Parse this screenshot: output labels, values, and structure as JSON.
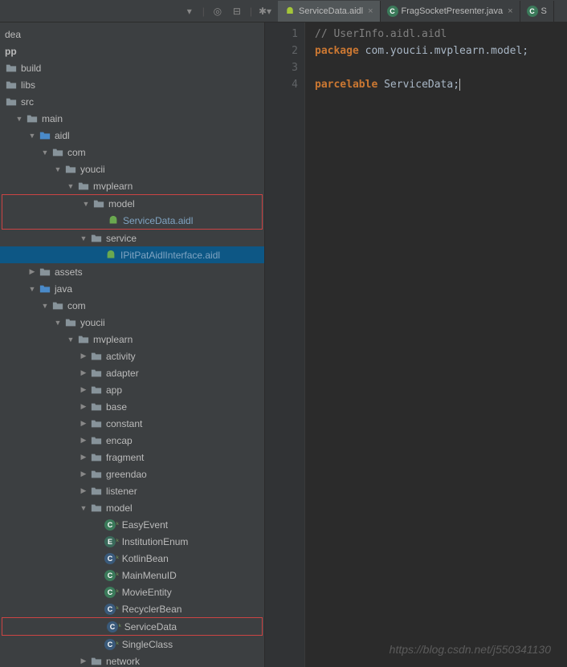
{
  "toolbar": {
    "tabs": [
      {
        "label": "ServiceData.aidl",
        "icon": "aidl"
      },
      {
        "label": "FragSocketPresenter.java",
        "icon": "class"
      },
      {
        "label": "S",
        "icon": "class"
      }
    ]
  },
  "tree": {
    "dea": "dea",
    "pp": "pp",
    "build": "build",
    "libs": "libs",
    "src": "src",
    "main": "main",
    "aidl": "aidl",
    "com": "com",
    "youcii": "youcii",
    "mvplearn": "mvplearn",
    "model": "model",
    "serviceDataAidl": "ServiceData.aidl",
    "service": "service",
    "iPitPatAidl": "IPitPatAidlInterface.aidl",
    "assets": "assets",
    "java": "java",
    "activity": "activity",
    "adapter": "adapter",
    "app": "app",
    "base": "base",
    "constant": "constant",
    "encap": "encap",
    "fragment": "fragment",
    "greendao": "greendao",
    "listener": "listener",
    "easyEvent": "EasyEvent",
    "institutionEnum": "InstitutionEnum",
    "kotlinBean": "KotlinBean",
    "mainMenuID": "MainMenuID",
    "movieEntity": "MovieEntity",
    "recyclerBean": "RecyclerBean",
    "serviceData": "ServiceData",
    "singleClass": "SingleClass",
    "network": "network"
  },
  "editor": {
    "line1": "// UserInfo.aidl.aidl",
    "line2_kw": "package",
    "line2_rest": " com.youcii.mvplearn.model;",
    "line4_kw": "parcelable",
    "line4_rest": " ServiceData;"
  },
  "watermark": "https://blog.csdn.net/j550341130"
}
